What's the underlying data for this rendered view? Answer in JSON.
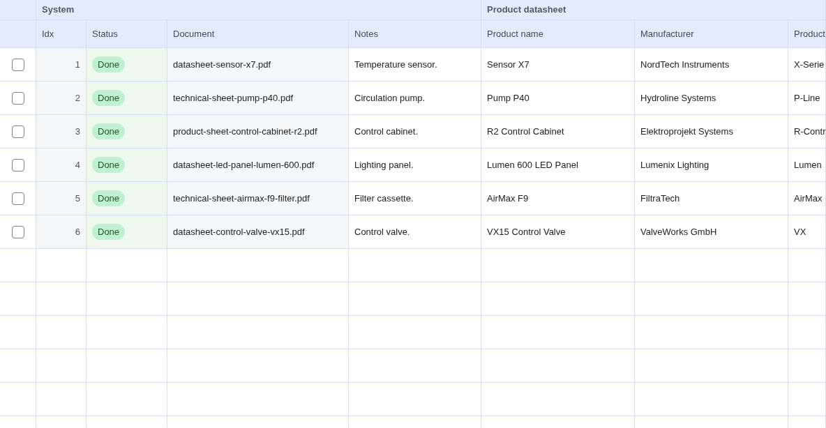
{
  "table": {
    "groups": [
      {
        "label": "System",
        "columns": [
          {
            "label": "Idx",
            "kind": "number"
          },
          {
            "label": "Status",
            "kind": "status"
          },
          {
            "label": "Document",
            "kind": "document"
          },
          {
            "label": "Notes",
            "kind": "text"
          }
        ]
      },
      {
        "label": "Product datasheet",
        "columns": [
          {
            "label": "Product name",
            "kind": "text"
          },
          {
            "label": "Manufacturer",
            "kind": "text"
          },
          {
            "label": "Product",
            "kind": "text"
          }
        ]
      }
    ],
    "rows": [
      {
        "checked": false,
        "cells": [
          "1",
          "Done",
          "datasheet-sensor-x7.pdf",
          "Temperature sensor.",
          "Sensor X7",
          "NordTech Instruments",
          "X-Serie"
        ]
      },
      {
        "checked": false,
        "cells": [
          "2",
          "Done",
          "technical-sheet-pump-p40.pdf",
          "Circulation pump.",
          "Pump P40",
          "Hydroline Systems",
          "P-Line"
        ]
      },
      {
        "checked": false,
        "cells": [
          "3",
          "Done",
          "product-sheet-control-cabinet-r2.pdf",
          "Control cabinet.",
          "R2 Control Cabinet",
          "Elektroprojekt Systems",
          "R-Contr"
        ]
      },
      {
        "checked": false,
        "cells": [
          "4",
          "Done",
          "datasheet-led-panel-lumen-600.pdf",
          "Lighting panel.",
          "Lumen 600 LED Panel",
          "Lumenix Lighting",
          "Lumen"
        ]
      },
      {
        "checked": false,
        "cells": [
          "5",
          "Done",
          "technical-sheet-airmax-f9-filter.pdf",
          "Filter cassette.",
          "AirMax F9",
          "FiltraTech",
          "AirMax"
        ]
      },
      {
        "checked": false,
        "cells": [
          "6",
          "Done",
          "datasheet-control-valve-vx15.pdf",
          "Control valve.",
          "VX15 Control Valve",
          "ValveWorks GmbH",
          "VX"
        ]
      }
    ]
  }
}
